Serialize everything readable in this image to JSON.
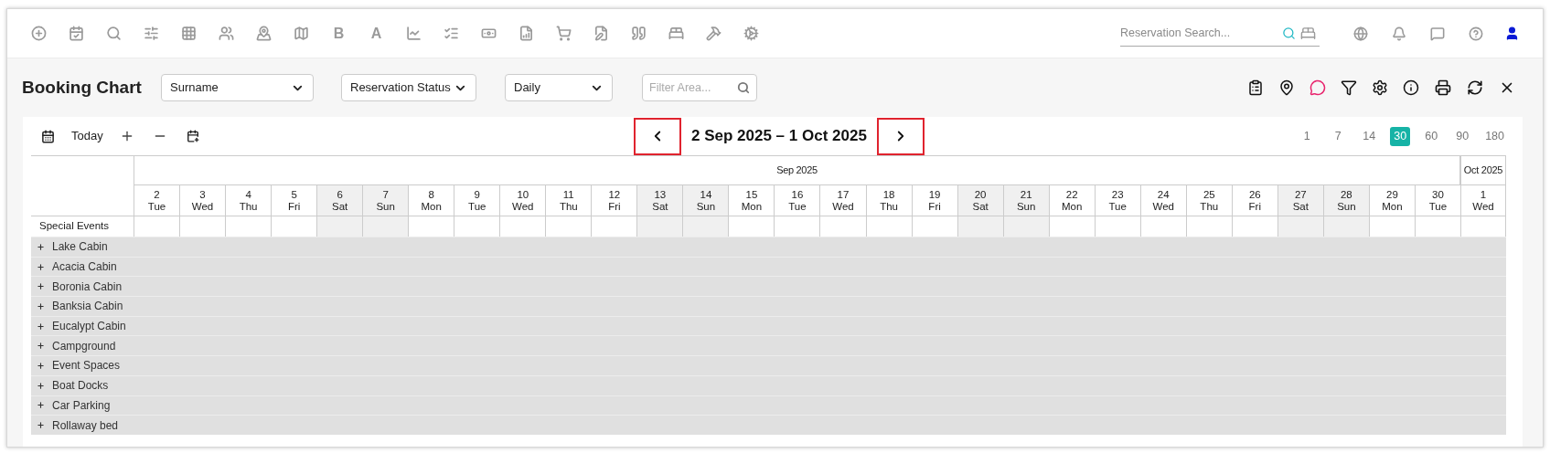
{
  "app_toolbar": {
    "letter_buttons": [
      "B",
      "A"
    ]
  },
  "reservation_search": {
    "placeholder": "Reservation Search..."
  },
  "page": {
    "title": "Booking Chart"
  },
  "filters": [
    {
      "value": "Surname"
    },
    {
      "value": "Reservation Status"
    },
    {
      "value": "Daily"
    }
  ],
  "filter_area": {
    "placeholder": "Filter Area..."
  },
  "chart_toolbar": {
    "today": "Today",
    "date_range": "2 Sep 2025 – 1 Oct 2025"
  },
  "zoom_levels": [
    {
      "label": "1",
      "selected": false
    },
    {
      "label": "7",
      "selected": false
    },
    {
      "label": "14",
      "selected": false
    },
    {
      "label": "30",
      "selected": true
    },
    {
      "label": "60",
      "selected": false
    },
    {
      "label": "90",
      "selected": false
    },
    {
      "label": "180",
      "selected": false
    }
  ],
  "months": [
    {
      "label": "Sep 2025",
      "days": [
        {
          "day": "2",
          "weekday": "Tue",
          "weekend": false
        },
        {
          "day": "3",
          "weekday": "Wed",
          "weekend": false
        },
        {
          "day": "4",
          "weekday": "Thu",
          "weekend": false
        },
        {
          "day": "5",
          "weekday": "Fri",
          "weekend": false
        },
        {
          "day": "6",
          "weekday": "Sat",
          "weekend": true
        },
        {
          "day": "7",
          "weekday": "Sun",
          "weekend": true
        },
        {
          "day": "8",
          "weekday": "Mon",
          "weekend": false
        },
        {
          "day": "9",
          "weekday": "Tue",
          "weekend": false
        },
        {
          "day": "10",
          "weekday": "Wed",
          "weekend": false
        },
        {
          "day": "11",
          "weekday": "Thu",
          "weekend": false
        },
        {
          "day": "12",
          "weekday": "Fri",
          "weekend": false
        },
        {
          "day": "13",
          "weekday": "Sat",
          "weekend": true
        },
        {
          "day": "14",
          "weekday": "Sun",
          "weekend": true
        },
        {
          "day": "15",
          "weekday": "Mon",
          "weekend": false
        },
        {
          "day": "16",
          "weekday": "Tue",
          "weekend": false
        },
        {
          "day": "17",
          "weekday": "Wed",
          "weekend": false
        },
        {
          "day": "18",
          "weekday": "Thu",
          "weekend": false
        },
        {
          "day": "19",
          "weekday": "Fri",
          "weekend": false
        },
        {
          "day": "20",
          "weekday": "Sat",
          "weekend": true
        },
        {
          "day": "21",
          "weekday": "Sun",
          "weekend": true
        },
        {
          "day": "22",
          "weekday": "Mon",
          "weekend": false
        },
        {
          "day": "23",
          "weekday": "Tue",
          "weekend": false
        },
        {
          "day": "24",
          "weekday": "Wed",
          "weekend": false
        },
        {
          "day": "25",
          "weekday": "Thu",
          "weekend": false
        },
        {
          "day": "26",
          "weekday": "Fri",
          "weekend": false
        },
        {
          "day": "27",
          "weekday": "Sat",
          "weekend": true
        },
        {
          "day": "28",
          "weekday": "Sun",
          "weekend": true
        },
        {
          "day": "29",
          "weekday": "Mon",
          "weekend": false
        },
        {
          "day": "30",
          "weekday": "Tue",
          "weekend": false
        }
      ]
    },
    {
      "label": "Oct 2025",
      "days": [
        {
          "day": "1",
          "weekday": "Wed",
          "weekend": false
        }
      ]
    }
  ],
  "special_events": {
    "label": "Special Events"
  },
  "resources": [
    {
      "name": "Lake Cabin",
      "expanded": false
    },
    {
      "name": "Acacia Cabin",
      "expanded": false
    },
    {
      "name": "Boronia Cabin",
      "expanded": false
    },
    {
      "name": "Banksia Cabin",
      "expanded": false
    },
    {
      "name": "Eucalypt Cabin",
      "expanded": false
    },
    {
      "name": "Campground",
      "expanded": false
    },
    {
      "name": "Event Spaces",
      "expanded": false
    },
    {
      "name": "Boat Docks",
      "expanded": false
    },
    {
      "name": "Car Parking",
      "expanded": false
    },
    {
      "name": "Rollaway bed",
      "expanded": false
    }
  ]
}
